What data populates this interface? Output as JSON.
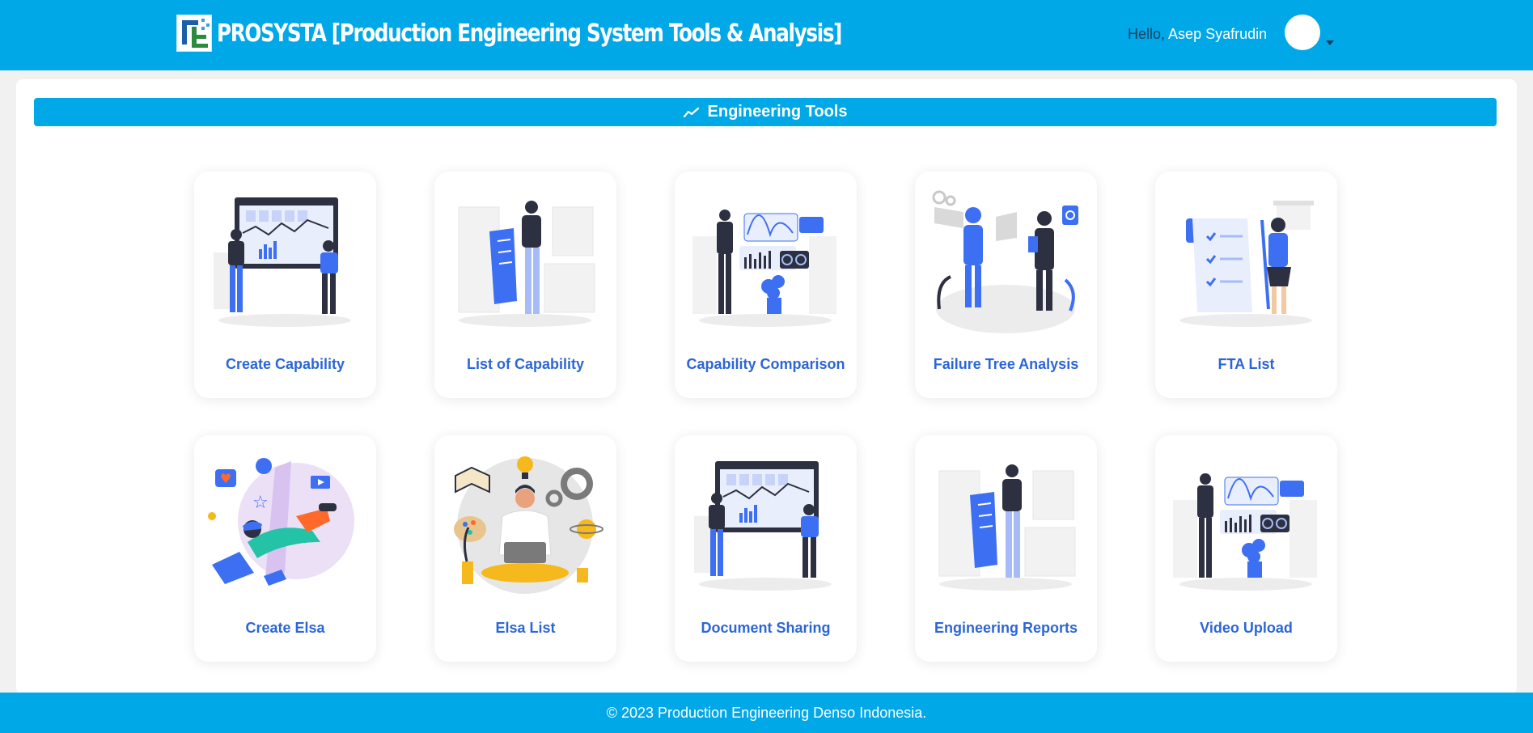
{
  "header": {
    "title": "PROSYSTA [Production Engineering System Tools & Analysis]",
    "logo_icon": "prosysta-logo",
    "greeting": "Hello,",
    "user_name": "Asep Syafrudin",
    "avatar_icon": "user-avatar",
    "dropdown_icon": "caret-down-icon"
  },
  "section": {
    "title": "Engineering Tools",
    "icon": "chart-line-icon"
  },
  "tools": [
    {
      "label": "Create Capability",
      "illustration": "dashboard-team-illustration"
    },
    {
      "label": "List of Capability",
      "illustration": "person-holding-list-illustration"
    },
    {
      "label": "Capability Comparison",
      "illustration": "analytics-screens-illustration"
    },
    {
      "label": "Failure Tree Analysis",
      "illustration": "vr-robot-illustration"
    },
    {
      "label": "FTA List",
      "illustration": "checklist-illustration"
    },
    {
      "label": "Create Elsa",
      "illustration": "creative-laptop-illustration"
    },
    {
      "label": "Elsa List",
      "illustration": "ideas-meditation-illustration"
    },
    {
      "label": "Document Sharing",
      "illustration": "dashboard-team-illustration"
    },
    {
      "label": "Engineering Reports",
      "illustration": "person-holding-list-illustration"
    },
    {
      "label": "Video Upload",
      "illustration": "analytics-screens-illustration"
    }
  ],
  "footer": {
    "text": "© 2023 Production Engineering Denso Indonesia."
  },
  "colors": {
    "primary": "#00a8e8",
    "link": "#2c66d6",
    "illustration_blue": "#3d6ff2"
  }
}
